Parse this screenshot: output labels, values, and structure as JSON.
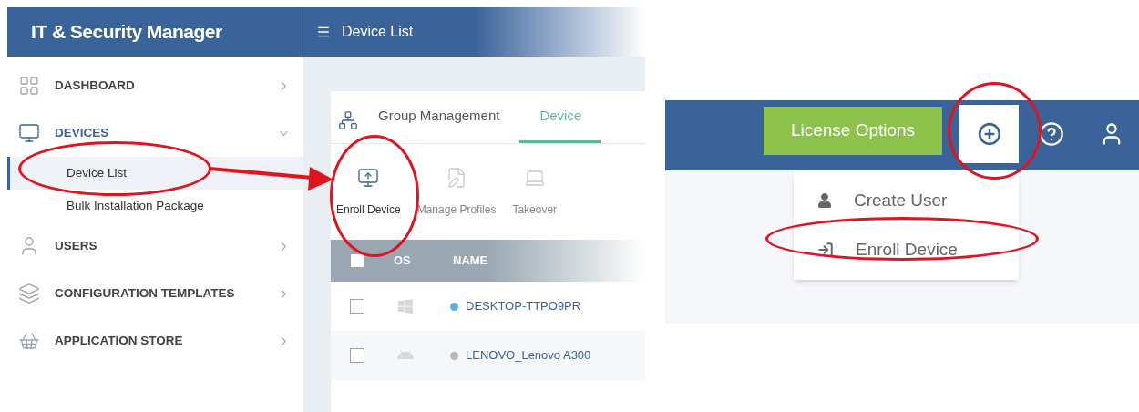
{
  "app": {
    "title": "IT & Security Manager"
  },
  "sidebar": {
    "items": [
      {
        "label": "DASHBOARD",
        "expanded": false
      },
      {
        "label": "DEVICES",
        "expanded": true,
        "children": [
          {
            "label": "Device List",
            "selected": true
          },
          {
            "label": "Bulk Installation Package",
            "selected": false
          }
        ]
      },
      {
        "label": "USERS",
        "expanded": false
      },
      {
        "label": "CONFIGURATION TEMPLATES",
        "expanded": false
      },
      {
        "label": "APPLICATION STORE",
        "expanded": false
      }
    ]
  },
  "page_header": {
    "title": "Device List"
  },
  "tabs": [
    {
      "label": "Group Management",
      "selected": false
    },
    {
      "label": "Device",
      "selected": true
    }
  ],
  "toolbar": [
    {
      "label": "Enroll Device",
      "disabled": false
    },
    {
      "label": "Manage Profiles",
      "disabled": true
    },
    {
      "label": "Takeover",
      "disabled": true
    }
  ],
  "table": {
    "select_all": {
      "checked": false
    },
    "columns": [
      "OS",
      "NAME"
    ],
    "rows": [
      {
        "kind": "windows",
        "color": "#5aaee0",
        "name": "DESKTOP-TTPO9PR",
        "checked": false
      },
      {
        "kind": "android",
        "color": "#b8b8b8",
        "name": "LENOVO_Lenovo A300",
        "checked": false
      }
    ]
  },
  "top_bar": {
    "license_button": "License Options"
  },
  "add_menu": {
    "items": [
      {
        "kind": "user",
        "label": "Create User"
      },
      {
        "kind": "enroll",
        "label": "Enroll Device"
      }
    ]
  }
}
